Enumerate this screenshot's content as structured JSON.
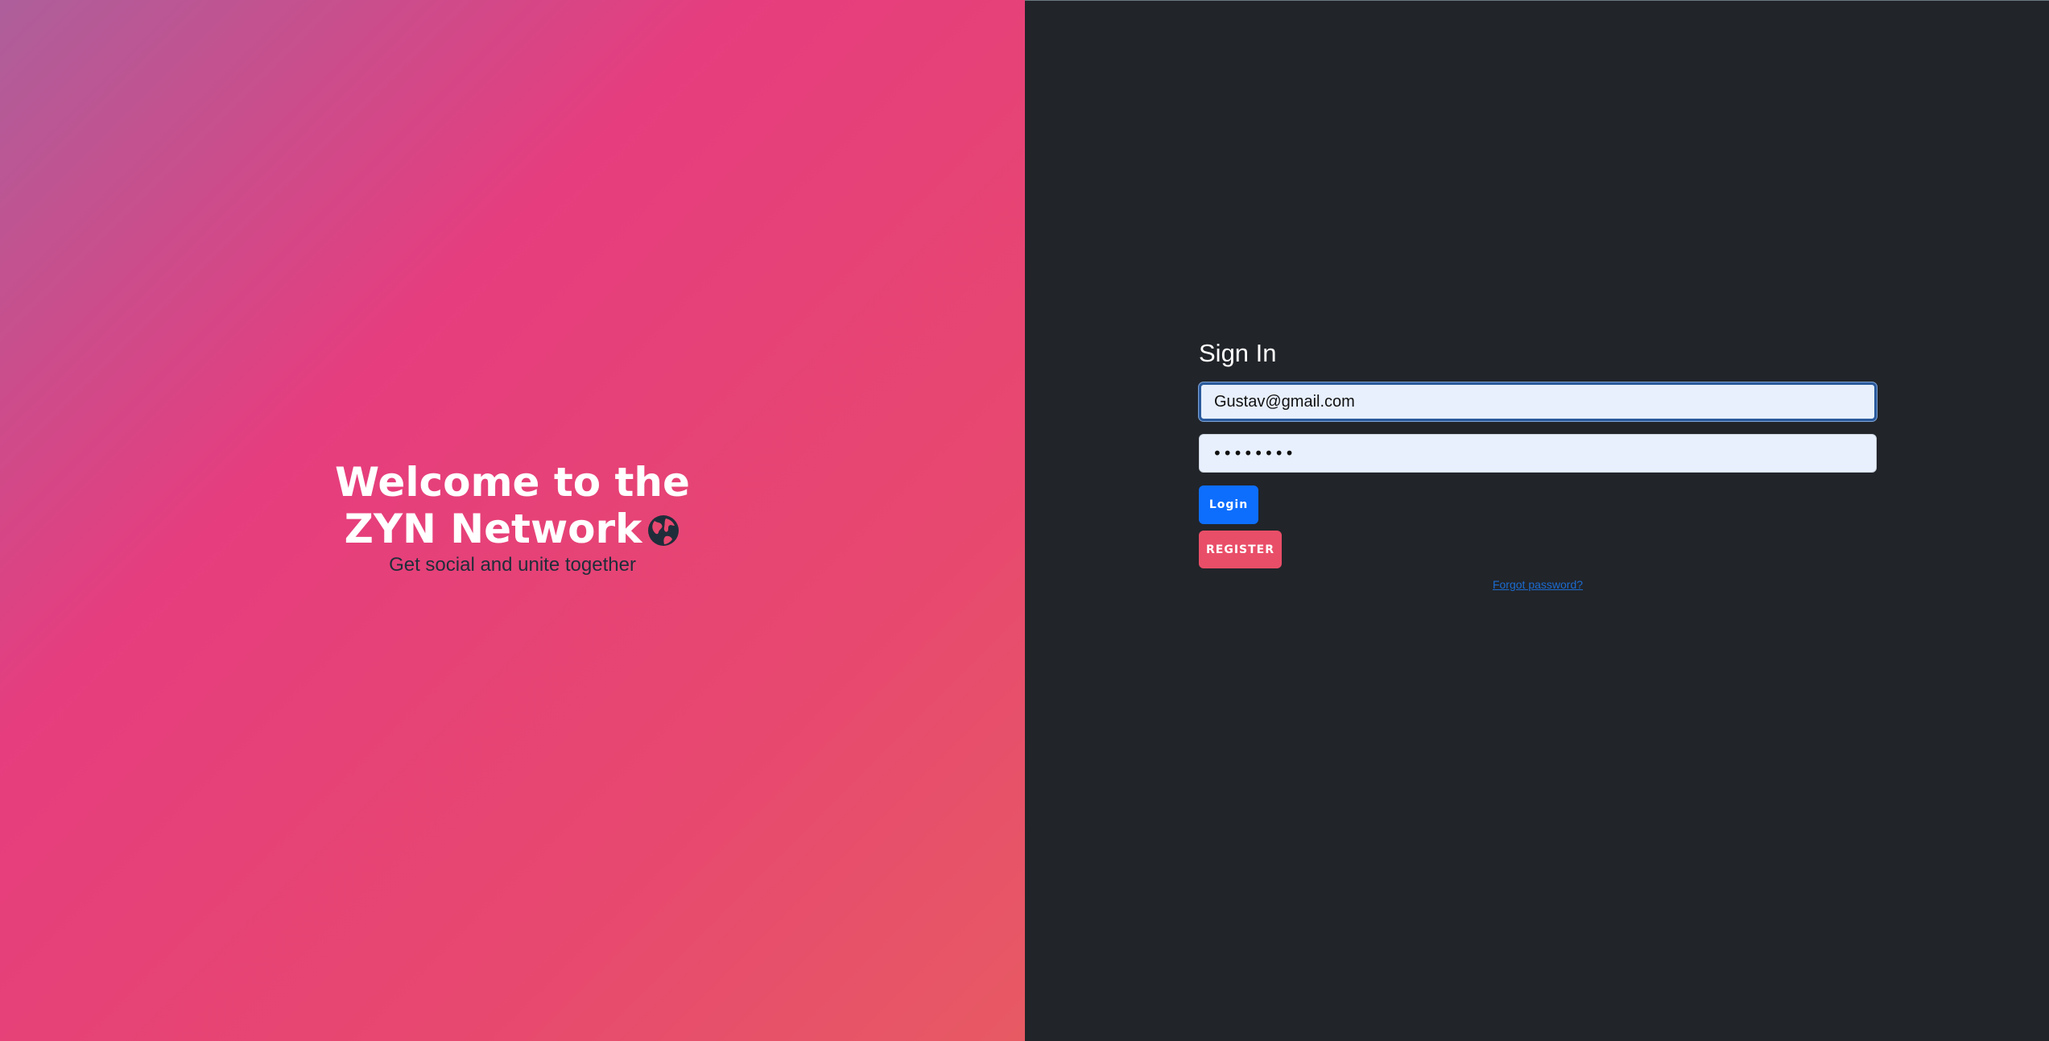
{
  "welcome": {
    "title": "Welcome to the ZYN Network",
    "subtitle": "Get social and unite together",
    "icon": "globe-icon"
  },
  "signin": {
    "title": "Sign In",
    "email_value": "Gustav@gmail.com",
    "password_value": "12345678",
    "login_label": "Login",
    "register_label": "REGISTER",
    "forgot_label": "Forgot password?"
  },
  "colors": {
    "gradient_start": "#ad5f9b",
    "gradient_mid": "#e63d7e",
    "gradient_end": "#e75a63",
    "right_bg": "#212429",
    "login_btn": "#0d6efd",
    "register_btn": "#e94e68",
    "link": "#1c6bd0"
  }
}
